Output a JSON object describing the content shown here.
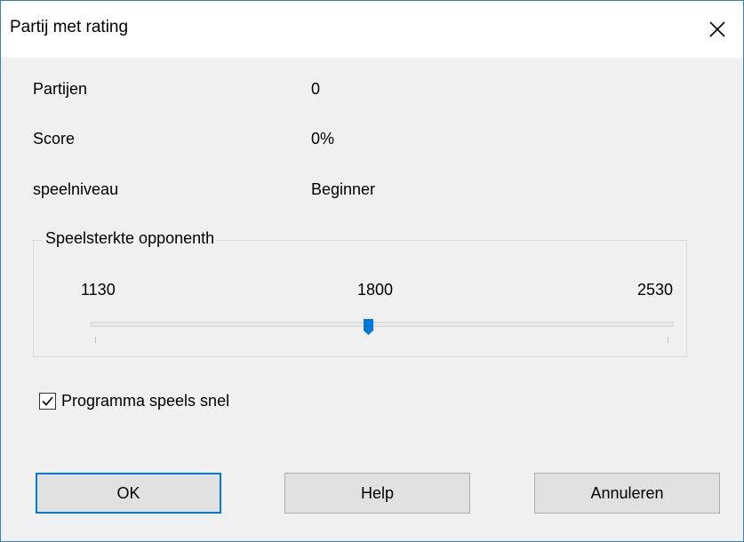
{
  "window": {
    "title": "Partij met rating"
  },
  "stats": {
    "games_label": "Partijen",
    "games_value": "0",
    "score_label": "Score",
    "score_value": "0%",
    "level_label": "speelniveau",
    "level_value": "Beginner"
  },
  "opponent": {
    "group_title": "Speelsterkte opponenth",
    "min_label": "1130",
    "mid_label": "1800",
    "max_label": "2530",
    "slider_value": 1800,
    "slider_min": 1130,
    "slider_max": 2530
  },
  "options": {
    "fast_play_label": "Programma speels snel",
    "fast_play_checked": true
  },
  "buttons": {
    "ok_label": "OK",
    "help_label": "Help",
    "cancel_label": "Annuleren"
  },
  "colors": {
    "accent": "#0078d7",
    "window_border": "#3c7fb1"
  }
}
